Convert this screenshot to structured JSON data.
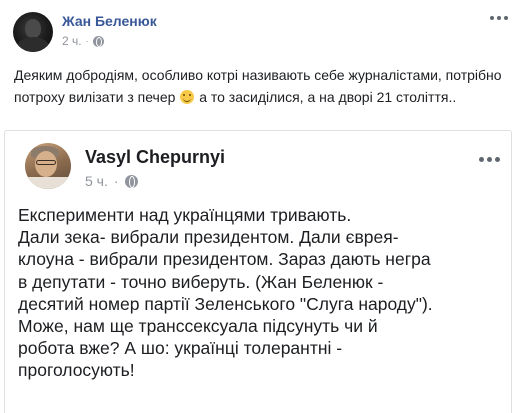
{
  "post": {
    "author": "Жан Беленюк",
    "time": "2 ч.",
    "separator": "·",
    "text_before_emoji": "Деяким добродіям, особливо котрі називають себе журналістами, потрібно потроху вилізати з печер",
    "emoji": "smiley",
    "text_after_emoji": " а то засиділися, а на дворі 21 століття..",
    "icons": [
      "globe-icon",
      "more-options-icon"
    ]
  },
  "shared_post": {
    "author": "Vasyl Chepurnyi",
    "time": "5 ч.",
    "separator": "·",
    "text": "Експерименти над українцями тривають.\nДали зека- вибрали президентом. Дали єврея-\nклоуна - вибрали президентом. Зараз дають негра\nв депутати - точно виберуть. (Жан Беленюк -\nдесятий номер партії Зеленського \"Слуга народу\").\nМоже, нам ще  транссексуала підсунуть чи й\nробота вже? А шо: українці толерантні -\nпроголосують!",
    "icons": [
      "globe-icon",
      "more-options-icon"
    ]
  },
  "colors": {
    "author_link": "#385898",
    "meta_gray": "#90949c",
    "text": "#1c1e21",
    "border": "#dddfe2"
  }
}
